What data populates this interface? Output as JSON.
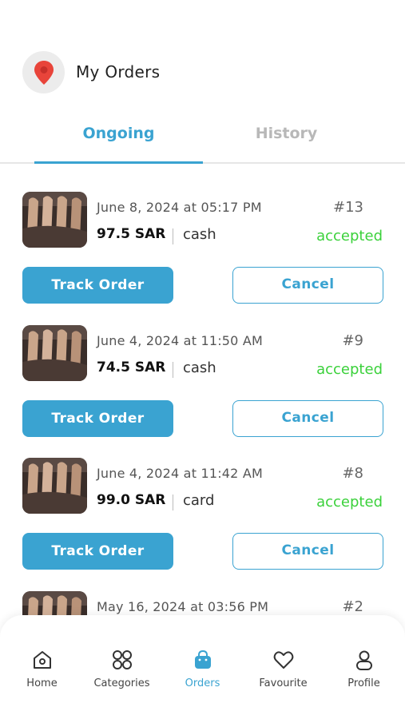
{
  "header": {
    "title": "My Orders",
    "location_icon": "map-pin-icon"
  },
  "tabs": [
    {
      "label": "Ongoing",
      "active": true
    },
    {
      "label": "History",
      "active": false
    }
  ],
  "orders": [
    {
      "date": "June 8, 2024 at 05:17 PM",
      "number": "#13",
      "price": "97.5 SAR",
      "payment": "cash",
      "status": "accepted",
      "track_label": "Track Order",
      "cancel_label": "Cancel"
    },
    {
      "date": "June 4, 2024 at 11:50 AM",
      "number": "#9",
      "price": "74.5 SAR",
      "payment": "cash",
      "status": "accepted",
      "track_label": "Track Order",
      "cancel_label": "Cancel"
    },
    {
      "date": "June 4, 2024 at 11:42 AM",
      "number": "#8",
      "price": "99.0 SAR",
      "payment": "card",
      "status": "accepted",
      "track_label": "Track Order",
      "cancel_label": "Cancel"
    },
    {
      "date": "May 16, 2024 at 03:56 PM",
      "number": "#2"
    }
  ],
  "nav": [
    {
      "label": "Home",
      "icon": "home-icon",
      "active": false
    },
    {
      "label": "Categories",
      "icon": "grid-icon",
      "active": false
    },
    {
      "label": "Orders",
      "icon": "bag-icon",
      "active": true
    },
    {
      "label": "Favourite",
      "icon": "heart-icon",
      "active": false
    },
    {
      "label": "Profile",
      "icon": "user-icon",
      "active": false
    }
  ],
  "colors": {
    "accent": "#3aa3d1",
    "status_accepted": "#3bd13b",
    "pin": "#e8443a"
  }
}
